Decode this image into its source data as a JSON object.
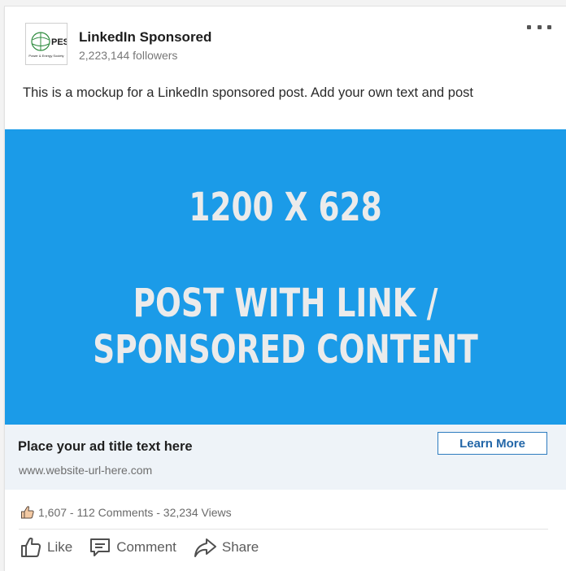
{
  "post": {
    "company_name": "LinkedIn Sponsored",
    "followers": "2,223,144 followers",
    "text": "This is a mockup for a LinkedIn sponsored post. Add your own text and post",
    "logo_text": "PES",
    "logo_subtext": "Power & Energy Society"
  },
  "image": {
    "line1": "1200 X 628",
    "line2": "POST WITH LINK /",
    "line3": "SPONSORED CONTENT",
    "background_color": "#1b9be8"
  },
  "link": {
    "title": "Place your ad title text here",
    "url": "www.website-url-here.com",
    "button_label": "Learn More"
  },
  "stats": {
    "text": "1,607 - 112 Comments - 32,234 Views"
  },
  "actions": {
    "like": "Like",
    "comment": "Comment",
    "share": "Share"
  }
}
